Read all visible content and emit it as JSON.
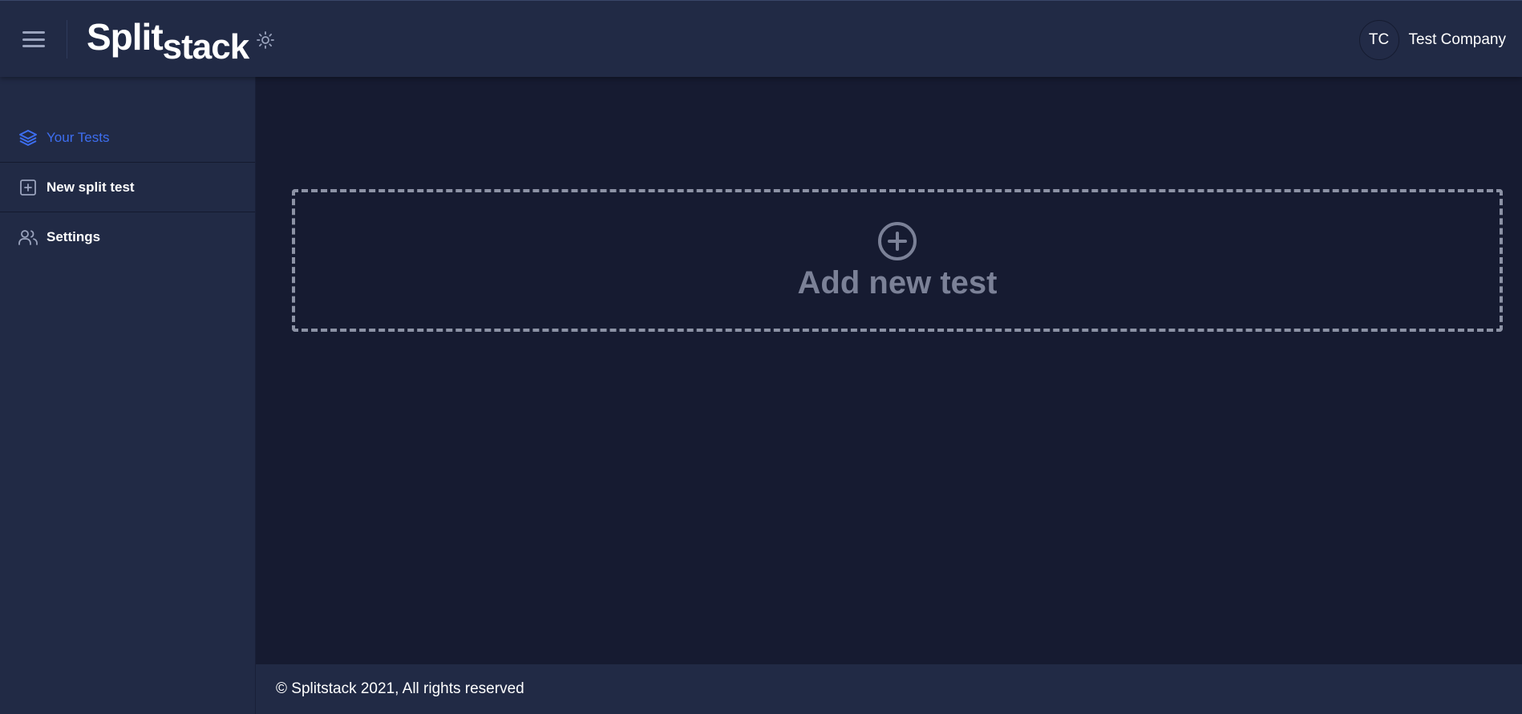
{
  "header": {
    "logo_part1": "Split",
    "logo_part2": "stack",
    "avatar_initials": "TC",
    "company_name": "Test Company"
  },
  "sidebar": {
    "items": [
      {
        "label": "Your Tests",
        "icon": "layers-icon",
        "active": true
      },
      {
        "label": "New split test",
        "icon": "plus-square-icon",
        "active": false
      },
      {
        "label": "Settings",
        "icon": "users-icon",
        "active": false
      }
    ]
  },
  "main": {
    "add_card_label": "Add new test"
  },
  "footer": {
    "copyright": "© Splitstack 2021, All rights reserved"
  },
  "colors": {
    "background": "#161b31",
    "panel": "#212a45",
    "accent": "#3d6ef0",
    "muted": "#7b8197"
  }
}
